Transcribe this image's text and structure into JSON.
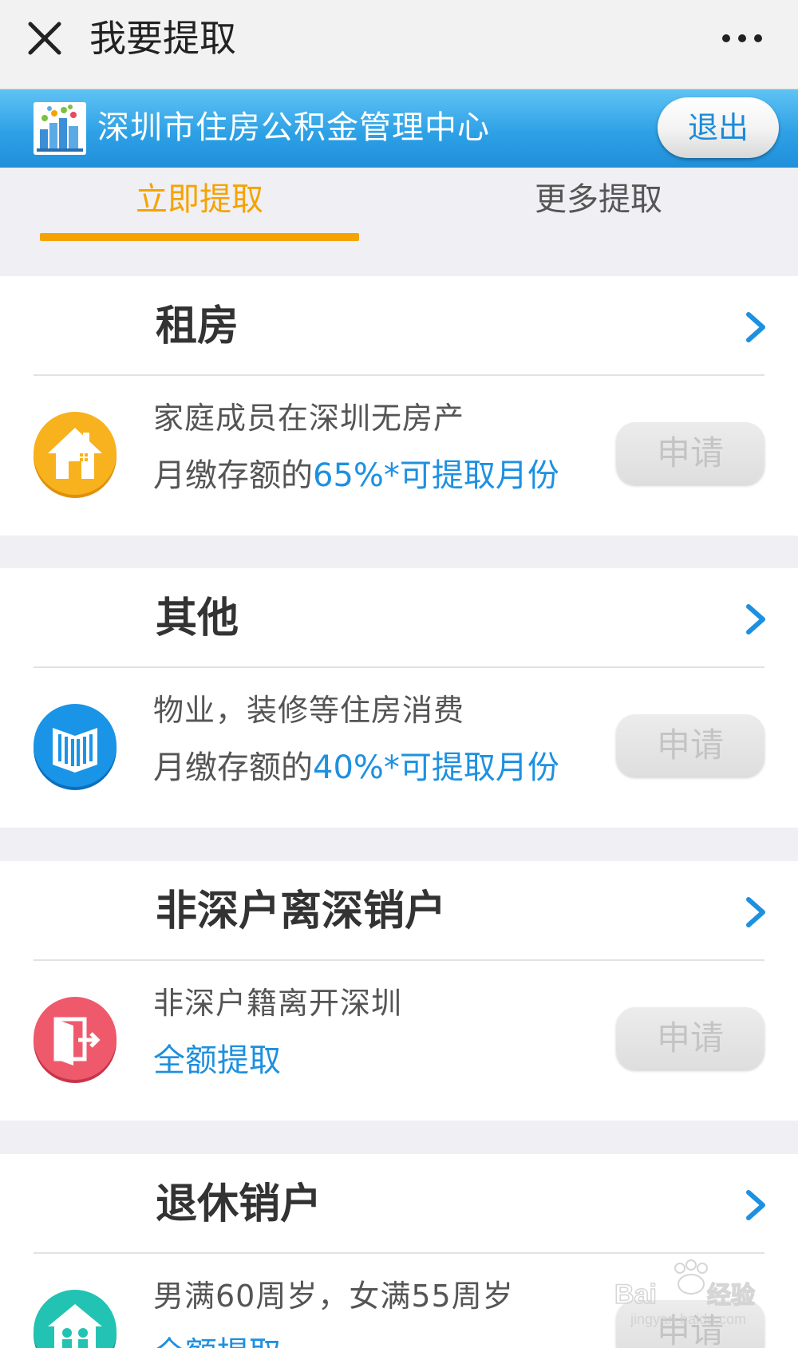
{
  "topbar": {
    "title": "我要提取"
  },
  "header": {
    "title": "深圳市住房公积金管理中心",
    "logout_label": "退出"
  },
  "tabs": [
    {
      "label": "立即提取",
      "active": true
    },
    {
      "label": "更多提取",
      "active": false
    }
  ],
  "colors": {
    "accent": "#f5a300",
    "brand_blue": "#1e90e0",
    "header_blue": "#2ea1e6"
  },
  "cards": [
    {
      "title": "租房",
      "icon": "house-icon",
      "icon_color": "#f5a300",
      "line1": "家庭成员在深圳无房产",
      "line2_prefix": "月缴存额的",
      "line2_highlight": "65%*可提取月份",
      "button": "申请"
    },
    {
      "title": "其他",
      "icon": "book-icon",
      "icon_color": "#1e90e0",
      "line1": "物业，装修等住房消费",
      "line2_prefix": "月缴存额的",
      "line2_highlight": "40%*可提取月份",
      "button": "申请"
    },
    {
      "title": "非深户离深销户",
      "icon": "exit-door-icon",
      "icon_color": "#e8495b",
      "line1": "非深户籍离开深圳",
      "line2_prefix": "",
      "line2_highlight": "全额提取",
      "button": "申请"
    },
    {
      "title": "退休销户",
      "icon": "elderly-home-icon",
      "icon_color": "#20c0b0",
      "line1": "男满60周岁，女满55周岁",
      "line2_prefix": "",
      "line2_highlight": "全额提取",
      "button": "申请"
    }
  ],
  "watermark": {
    "brand": "Baidu经验",
    "url": "jingyan.baidu.com"
  }
}
